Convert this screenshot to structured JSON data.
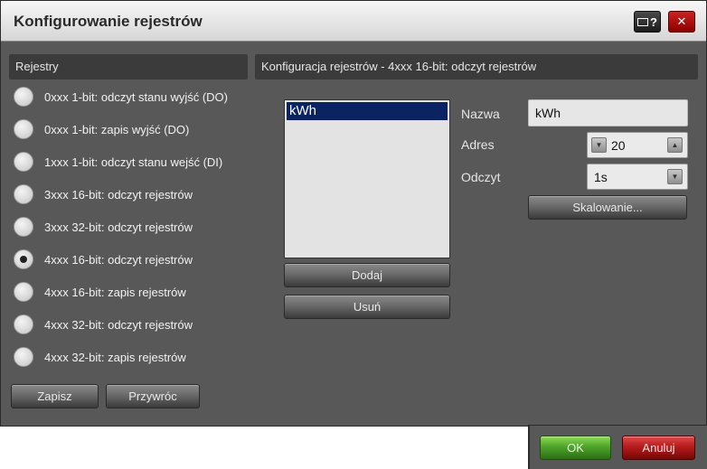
{
  "window": {
    "title": "Konfigurowanie rejestrów",
    "help_label": "?",
    "close_label": "✕"
  },
  "left_panel": {
    "header": "Rejestry",
    "registers": [
      {
        "label": "0xxx 1-bit: odczyt stanu wyjść (DO)",
        "checked": false
      },
      {
        "label": "0xxx 1-bit: zapis wyjść (DO)",
        "checked": false
      },
      {
        "label": "1xxx 1-bit: odczyt stanu wejść (DI)",
        "checked": false
      },
      {
        "label": "3xxx 16-bit: odczyt rejestrów",
        "checked": false
      },
      {
        "label": "3xxx 32-bit: odczyt rejestrów",
        "checked": false
      },
      {
        "label": "4xxx 16-bit: odczyt rejestrów",
        "checked": true
      },
      {
        "label": "4xxx 16-bit: zapis rejestrów",
        "checked": false
      },
      {
        "label": "4xxx 32-bit: odczyt rejestrów",
        "checked": false
      },
      {
        "label": "4xxx 32-bit: zapis rejestrów",
        "checked": false
      }
    ],
    "save_label": "Zapisz",
    "restore_label": "Przywróc"
  },
  "right_panel": {
    "header": "Konfiguracja rejestrów - 4xxx 16-bit: odczyt rejestrów",
    "list": {
      "items": [
        "kWh"
      ],
      "selected": "kWh"
    },
    "add_label": "Dodaj",
    "remove_label": "Usuń",
    "fields": {
      "name_label": "Nazwa",
      "name_value": "kWh",
      "address_label": "Adres",
      "address_value": "20",
      "read_label": "Odczyt",
      "read_value": "1s"
    },
    "scaling_label": "Skalowanie..."
  },
  "footer": {
    "ok_label": "OK",
    "cancel_label": "Anuluj"
  },
  "colors": {
    "ok": "#4ea52a",
    "cancel": "#b51c1c",
    "selection": "#0b2461"
  }
}
